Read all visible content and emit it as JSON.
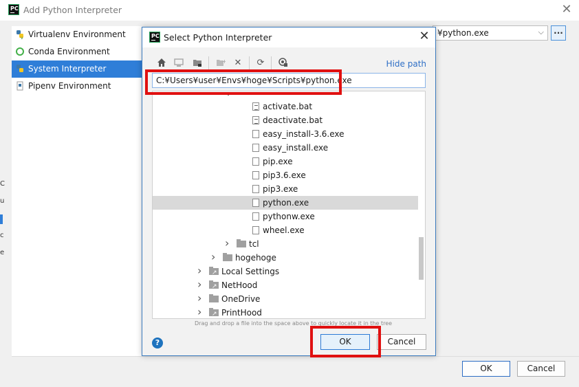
{
  "outer": {
    "title": "Add Python Interpreter",
    "logo_text": "PC",
    "environments": [
      {
        "label": "Virtualenv Environment",
        "icon": "python-venv-icon"
      },
      {
        "label": "Conda Environment",
        "icon": "conda-icon"
      },
      {
        "label": "System Interpreter",
        "icon": "python-icon",
        "selected": true
      },
      {
        "label": "Pipenv Environment",
        "icon": "pipenv-icon"
      }
    ],
    "interpreter_value": "¥python.exe",
    "browse_label": "...",
    "ok_label": "OK",
    "cancel_label": "Cancel",
    "edge_chars": [
      "C",
      "u",
      "c",
      "c",
      "e"
    ]
  },
  "dialog": {
    "title": "Select Python Interpreter",
    "logo_text": "PC",
    "hide_path_label": "Hide path",
    "path_value": "C:¥Users¥user¥Envs¥hoge¥Scripts¥python.exe",
    "toolbar_icons": [
      "home-icon",
      "desktop-icon",
      "project-folder-icon",
      "new-folder-icon",
      "delete-icon",
      "refresh-icon",
      "show-hidden-icon"
    ],
    "tree": [
      {
        "label": "activate.bat",
        "type": "bat"
      },
      {
        "label": "deactivate.bat",
        "type": "bat"
      },
      {
        "label": "easy_install-3.6.exe",
        "type": "exe"
      },
      {
        "label": "easy_install.exe",
        "type": "exe"
      },
      {
        "label": "pip.exe",
        "type": "exe"
      },
      {
        "label": "pip3.6.exe",
        "type": "exe"
      },
      {
        "label": "pip3.exe",
        "type": "exe"
      },
      {
        "label": "python.exe",
        "type": "exe",
        "selected": true
      },
      {
        "label": "pythonw.exe",
        "type": "exe"
      },
      {
        "label": "wheel.exe",
        "type": "exe"
      },
      {
        "label": "tcl",
        "type": "folder"
      },
      {
        "label": "hogehoge",
        "type": "folder"
      },
      {
        "label": "Local Settings",
        "type": "folder-link"
      },
      {
        "label": "NetHood",
        "type": "folder-link"
      },
      {
        "label": "OneDrive",
        "type": "folder"
      },
      {
        "label": "PrintHood",
        "type": "folder-link"
      }
    ],
    "drag_hint": "Drag and drop a file into the space above to quickly locate it in the tree",
    "ok_label": "OK",
    "cancel_label": "Cancel",
    "help_label": "?"
  },
  "colors": {
    "selection_blue": "#2f7ed8",
    "highlight_red": "#e01010",
    "link_blue": "#2f6fc6"
  }
}
